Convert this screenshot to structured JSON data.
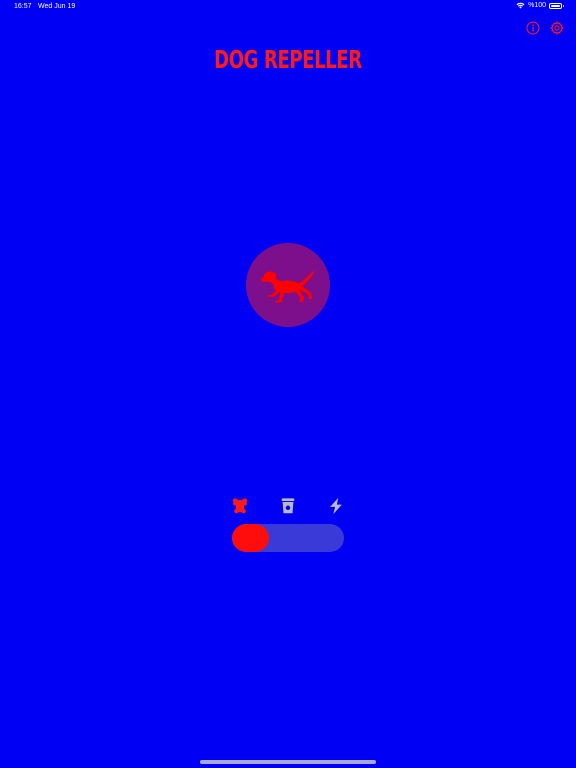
{
  "status_bar": {
    "time": "16:57",
    "date": "Wed Jun 19",
    "battery": "%100",
    "icons": [
      "wifi-icon",
      "battery-icon"
    ]
  },
  "header": {
    "title": "DOG REPELLER",
    "title_color": "#ff1a1a",
    "buttons": [
      {
        "name": "info-icon"
      },
      {
        "name": "gear-icon"
      }
    ]
  },
  "main_button": {
    "icon": "dog-running-icon",
    "color": "#7d0f8c",
    "icon_color": "#ff0000"
  },
  "modes": [
    {
      "name": "bone-icon",
      "active": true
    },
    {
      "name": "whistle-icon",
      "active": false
    },
    {
      "name": "lightning-icon",
      "active": false
    }
  ],
  "mode_slider": {
    "selected_index": 0,
    "thumb_color": "#ff0d0d"
  },
  "colors": {
    "background": "#0000f5",
    "accent": "#ff1a1a",
    "inactive_icon": "#b9b9c9"
  }
}
